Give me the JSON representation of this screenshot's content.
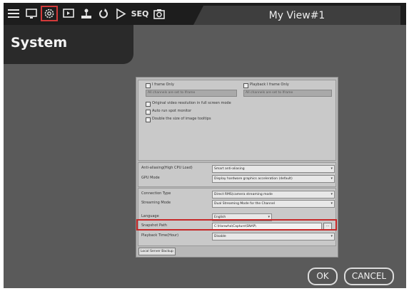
{
  "toolbar": {
    "icons": [
      "menu-icon",
      "monitor-icon",
      "settings-icon",
      "playback-icon",
      "network-icon",
      "sync-icon",
      "play-icon",
      "seq-label",
      "snapshot-icon"
    ],
    "seq_label": "SEQ",
    "active_color": "#d23a3a"
  },
  "view_tab": {
    "title": "My View#1"
  },
  "panel": {
    "title": "System"
  },
  "section1": {
    "iframe_only": "I frame Only",
    "iframe_note": "All channels are set to Iframe",
    "playback_iframe_only": "Playback I frame Only",
    "playback_note": "All channels are set to Iframe",
    "option1": "Original video resolution in full screen mode",
    "option2": "Auto run spot monitor",
    "option3": "Double the size of image tooltips"
  },
  "section2": {
    "antialias_label": "Anti-aliasing(High CPU Load)",
    "antialias_value": "Smart anti-aliasing",
    "gpu_label": "GPU Mode",
    "gpu_value": "Display hardware graphics acceleration (default)"
  },
  "section3": {
    "connection_label": "Connection Type",
    "connection_value": "Direct RMS(camera streaming mode",
    "streaming_label": "Streaming Mode",
    "streaming_value": "Dual Streaming Mode for the Channel",
    "language_label": "Language",
    "language_value": "English",
    "snapshot_label": "Snapshot Path",
    "snapshot_value": "C:\\Hanwha\\Capture\\SNAP\\",
    "browse_label": "...",
    "playback_time_label": "Playback Time(Hour)",
    "playback_time_value": "Disable"
  },
  "backup_button": "Local Server Backup",
  "buttons": {
    "ok": "OK",
    "cancel": "CANCEL"
  }
}
